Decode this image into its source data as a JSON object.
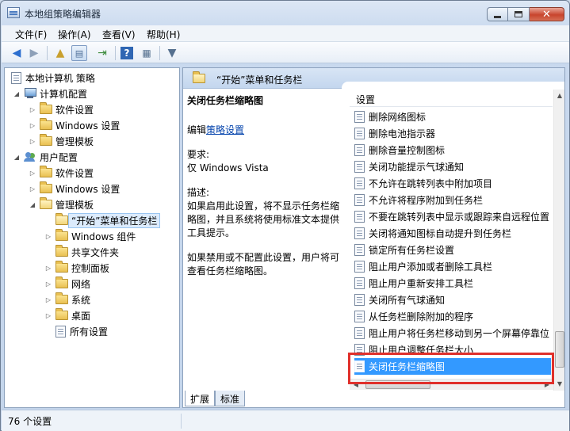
{
  "window": {
    "title": "本地组策略编辑器"
  },
  "menubar": {
    "items": [
      "文件(F)",
      "操作(A)",
      "查看(V)",
      "帮助(H)"
    ]
  },
  "toolbar": {
    "buttons": [
      "back-icon",
      "forward-icon",
      "up-folder-icon",
      "show-tree-icon",
      "export-icon",
      "help-icon",
      "properties-icon",
      "filter-icon"
    ]
  },
  "tree": {
    "root": "本地计算机 策略",
    "computer_config": "计算机配置",
    "computer_children": [
      "软件设置",
      "Windows 设置",
      "管理模板"
    ],
    "user_config": "用户配置",
    "user_children": [
      "软件设置",
      "Windows 设置",
      "管理模板"
    ],
    "admin_templates_children": [
      "“开始”菜单和任务栏",
      "Windows 组件",
      "共享文件夹",
      "控制面板",
      "网络",
      "系统",
      "桌面",
      "所有设置"
    ]
  },
  "right_pane": {
    "header_title": "“开始”菜单和任务栏",
    "description": {
      "title": "关闭任务栏缩略图",
      "edit_prefix": "编辑",
      "edit_link": "策略设置",
      "requirements_label": "要求:",
      "requirements_value": "仅 Windows Vista",
      "description_label": "描述:",
      "description_enabled": "如果启用此设置，将不显示任务栏缩略图，并且系统将使用标准文本提供工具提示。",
      "description_disabled": "如果禁用或不配置此设置，用户将可查看任务栏缩略图。"
    },
    "list_header": "设置",
    "settings": [
      "删除网络图标",
      "删除电池指示器",
      "删除音量控制图标",
      "关闭功能提示气球通知",
      "不允许在跳转列表中附加项目",
      "不允许将程序附加到任务栏",
      "不要在跳转列表中显示或跟踪来自远程位置",
      "关闭将通知图标自动提升到任务栏",
      "锁定所有任务栏设置",
      "阻止用户添加或者删除工具栏",
      "阻止用户重新安排工具栏",
      "关闭所有气球通知",
      "从任务栏删除附加的程序",
      "阻止用户将任务栏移动到另一个屏幕停靠位",
      "阻止用户调整任务栏大小",
      "关闭任务栏缩略图"
    ],
    "selected_index": 15
  },
  "tabs": {
    "extended": "扩展",
    "standard": "标准"
  },
  "statusbar": {
    "text": "76 个设置"
  },
  "colors": {
    "selection": "#3399ff",
    "highlight_box": "#e0302b"
  }
}
